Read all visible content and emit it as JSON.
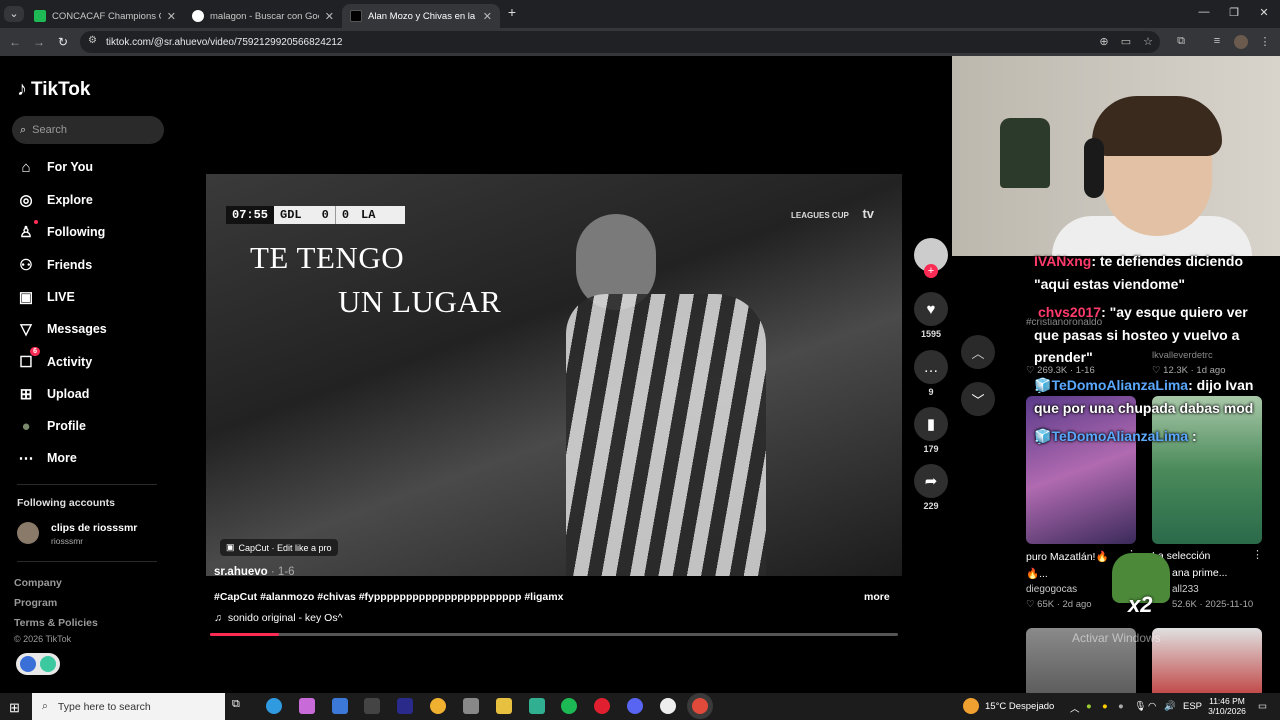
{
  "browser": {
    "tabs": [
      {
        "title": "CONCACAF Champions Cup pa",
        "favicon_color": "#1db954"
      },
      {
        "title": "malagon - Buscar con Google",
        "favicon_color": "#ffffff"
      },
      {
        "title": "Alan Mozo y Chivas en la Liga I",
        "favicon_color": "#000000"
      }
    ],
    "new_tab": "+",
    "url": "tiktok.com/@sr.ahuevo/video/7592129920566824212"
  },
  "sidebar": {
    "logo": "TikTok",
    "search_placeholder": "Search",
    "nav": [
      {
        "label": "For You",
        "icon": "home-icon",
        "glyph": "⌂"
      },
      {
        "label": "Explore",
        "icon": "compass-icon",
        "glyph": "◎"
      },
      {
        "label": "Following",
        "icon": "following-icon",
        "glyph": "♙"
      },
      {
        "label": "Friends",
        "icon": "friends-icon",
        "glyph": "⚇"
      },
      {
        "label": "LIVE",
        "icon": "live-icon",
        "glyph": "▣"
      },
      {
        "label": "Messages",
        "icon": "messages-icon",
        "glyph": "▽"
      },
      {
        "label": "Activity",
        "icon": "activity-icon",
        "glyph": "☐",
        "badge": "6"
      },
      {
        "label": "Upload",
        "icon": "upload-icon",
        "glyph": "⊞"
      },
      {
        "label": "Profile",
        "icon": "profile-avatar-icon",
        "glyph": "●"
      },
      {
        "label": "More",
        "icon": "more-icon",
        "glyph": "⋯"
      }
    ],
    "following_title": "Following accounts",
    "following_account": {
      "name": "clips de riosssmr",
      "handle": "riosssmr"
    },
    "footer": [
      "Company",
      "Program",
      "Terms & Policies"
    ],
    "copyright": "© 2026 TikTok"
  },
  "video": {
    "score": {
      "time": "07:55",
      "home": "GDL",
      "home_score": "0",
      "away_score": "0",
      "away": "LA"
    },
    "caption_line1": "TE TENGO",
    "caption_line2": "UN LUGAR",
    "brand_left": "LEAGUES CUP",
    "brand_right": "tv",
    "capcut": "CapCut · Edit like a pro",
    "author": "sr.ahuevo",
    "date": " · 1-6",
    "description": "#CapCut #alanmozo #chivas #fyppppppppppppppppppppppp #ligamx",
    "more": "more",
    "sound": "sonido original - key Os^  ",
    "progress": 0.1
  },
  "actions": {
    "likes": "1595",
    "comments": "9",
    "saves": "179",
    "shares": "229"
  },
  "right_panel": {
    "chat": [
      {
        "user": "IVANxng",
        "text": ": te defiendes diciendo"
      },
      {
        "user": "",
        "text": "\"aqui estas viendome\""
      },
      {
        "user": "chvs2017",
        "text": ": \"ay esque quiero ver"
      },
      {
        "user": "",
        "text": "que pasas si hosteo y vuelvo a"
      },
      {
        "user": "",
        "text": "prender\""
      },
      {
        "user": "TeDomoAlianzaLima",
        "text": ": dijo Ivan",
        "emoji": "🧊"
      },
      {
        "user": "",
        "text": "que por una chupada dabas mod"
      },
      {
        "user": "TeDomoAlianzaLima",
        "text": " :",
        "emoji": "🧊"
      }
    ],
    "bg_items": [
      {
        "text": "#cristianoronaldo"
      },
      {
        "text": "lkvalleverdetrc"
      },
      {
        "stat": "♡ 269.3K · 1-16"
      },
      {
        "stat": "♡ 12.3K · 1d ago"
      }
    ],
    "cards": [
      {
        "title": "puro Mazatlán!🔥",
        "title2": "🔥...",
        "user": "diegogocas",
        "stat": "♡ 65K · 2d ago"
      },
      {
        "title": "La selección",
        "title2": "ana prime...",
        "user": "all233",
        "stat": "52.6K · 2025-11-10"
      }
    ],
    "emote_text": "x2",
    "watermark": "Activar Windows"
  },
  "taskbar": {
    "search_placeholder": "Type here to search",
    "weather": "15°C  Despejado",
    "lang": "ESP",
    "time": "11:46 PM",
    "date": "3/10/2026"
  }
}
